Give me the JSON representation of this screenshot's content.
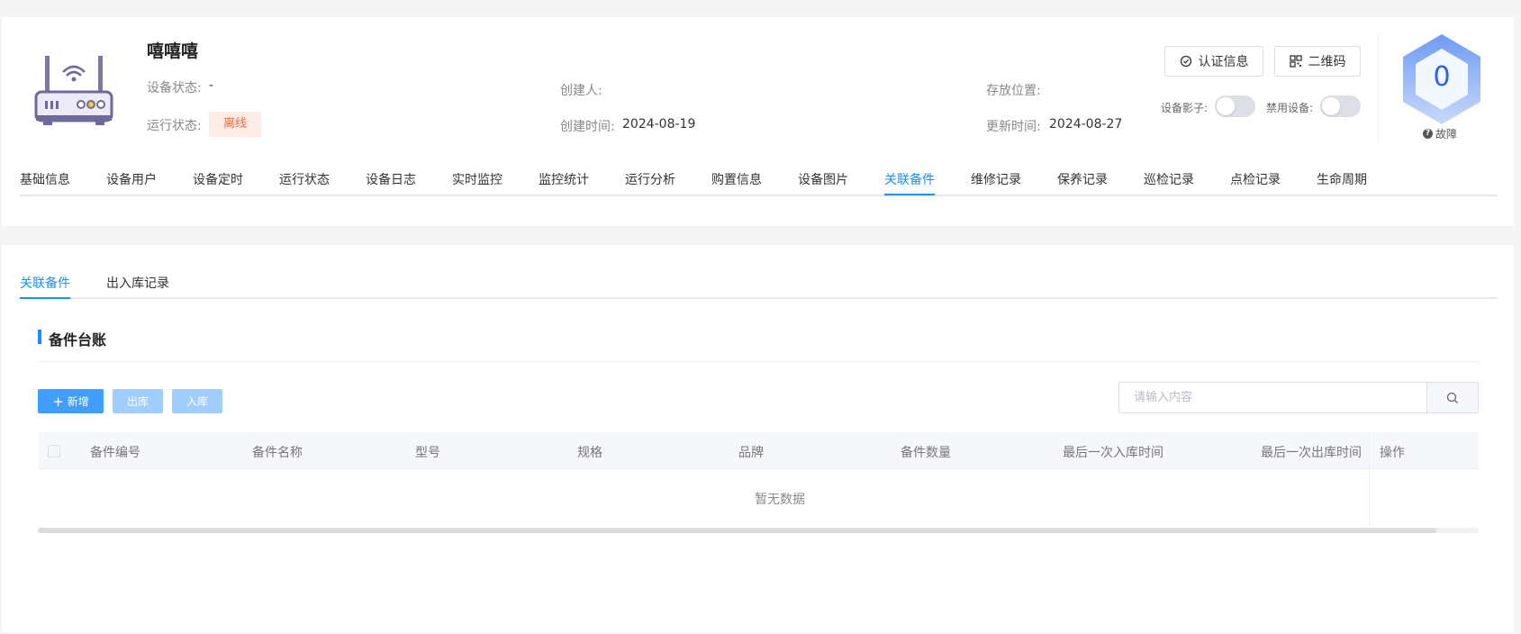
{
  "device": {
    "name": "嘻嘻嘻",
    "icon": "router-icon",
    "status_label": "设备状态:",
    "status_value": "-",
    "run_status_label": "运行状态:",
    "run_status_value": "离线",
    "creator_label": "创建人:",
    "creator_value": "",
    "created_label": "创建时间:",
    "created_value": "2024-08-19",
    "location_label": "存放位置:",
    "location_value": "",
    "updated_label": "更新时间:",
    "updated_value": "2024-08-27"
  },
  "actions": {
    "cert_label": "认证信息",
    "qrcode_label": "二维码",
    "shadow_label": "设备影子:",
    "disable_label": "禁用设备:"
  },
  "fault": {
    "count": "0",
    "label": "故障"
  },
  "main_tabs": [
    {
      "label": "基础信息"
    },
    {
      "label": "设备用户"
    },
    {
      "label": "设备定时"
    },
    {
      "label": "运行状态"
    },
    {
      "label": "设备日志"
    },
    {
      "label": "实时监控"
    },
    {
      "label": "监控统计"
    },
    {
      "label": "运行分析"
    },
    {
      "label": "购置信息"
    },
    {
      "label": "设备图片"
    },
    {
      "label": "关联备件"
    },
    {
      "label": "维修记录"
    },
    {
      "label": "保养记录"
    },
    {
      "label": "巡检记录"
    },
    {
      "label": "点检记录"
    },
    {
      "label": "生命周期"
    }
  ],
  "sub_tabs": [
    {
      "label": "关联备件"
    },
    {
      "label": "出入库记录"
    }
  ],
  "section": {
    "title": "备件台账"
  },
  "toolbar": {
    "add_label": "新增",
    "out_label": "出库",
    "in_label": "入库"
  },
  "search": {
    "placeholder": "请输入内容"
  },
  "table": {
    "columns": [
      "备件编号",
      "备件名称",
      "型号",
      "规格",
      "品牌",
      "备件数量",
      "最后一次入库时间",
      "最后一次出库时间",
      "操作"
    ],
    "empty_text": "暂无数据"
  },
  "colors": {
    "accent": "#1890ff",
    "offline_bg": "#fdebe6",
    "offline_text": "#f2693e",
    "fault_number": "#2a63e8"
  }
}
